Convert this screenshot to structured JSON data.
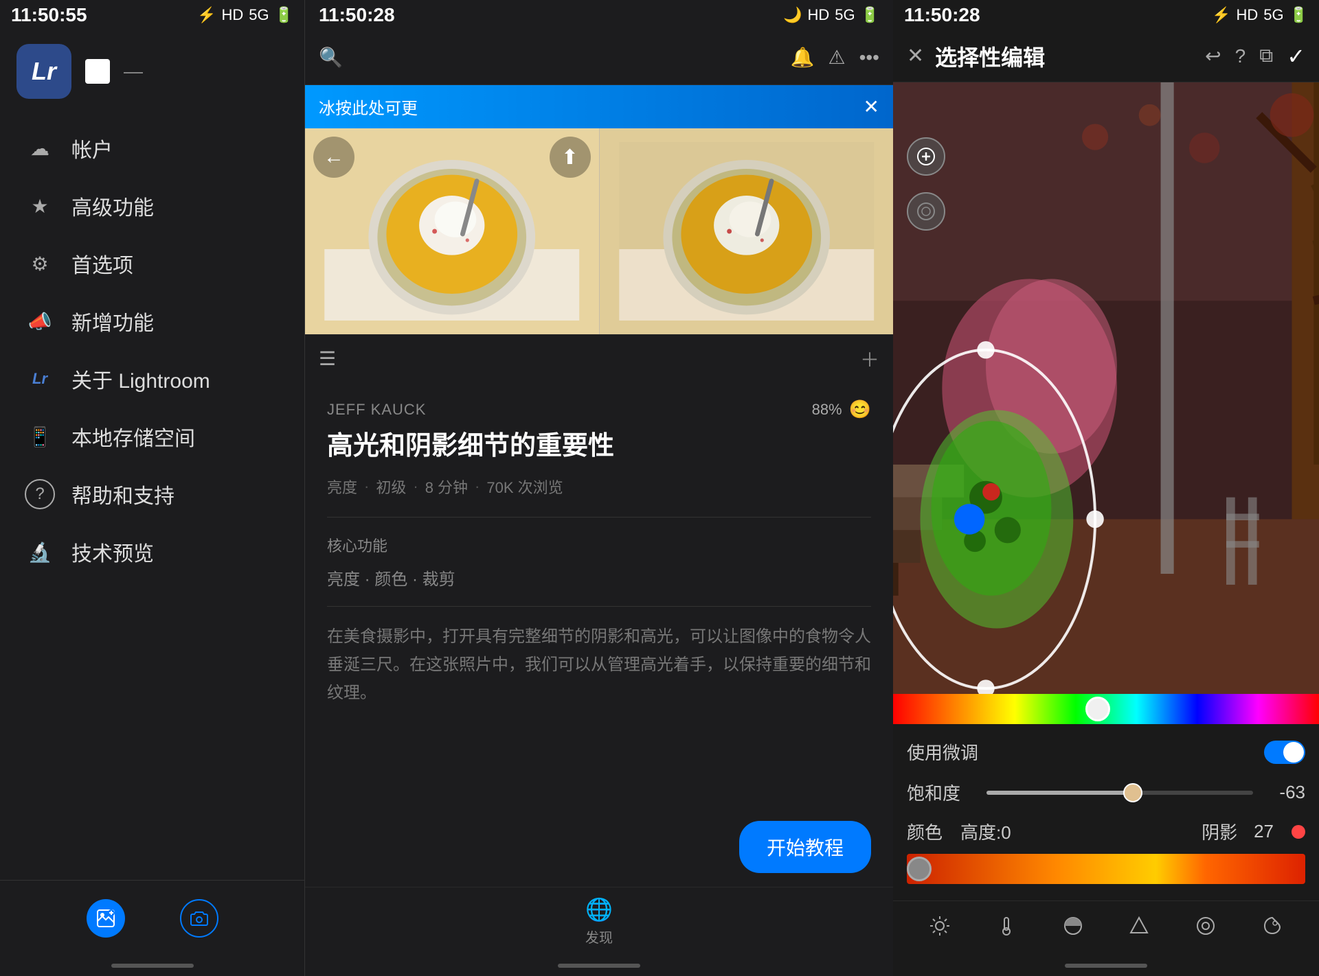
{
  "panel_left": {
    "status_bar": {
      "time": "11:50:55",
      "icons": "🔊 ⏱ A ..."
    },
    "logo": "Lr",
    "nav_items": [
      {
        "id": "account",
        "icon": "☁",
        "label": "帐户"
      },
      {
        "id": "advanced",
        "icon": "★",
        "label": "高级功能"
      },
      {
        "id": "preferences",
        "icon": "⚙",
        "label": "首选项"
      },
      {
        "id": "new_features",
        "icon": "📣",
        "label": "新增功能"
      },
      {
        "id": "about",
        "icon": "Lr",
        "label": "关于 Lightroom"
      },
      {
        "id": "local_storage",
        "icon": "📱",
        "label": "本地存储空间"
      },
      {
        "id": "help",
        "icon": "?",
        "label": "帮助和支持"
      },
      {
        "id": "tech_preview",
        "icon": "🔬",
        "label": "技术预览"
      }
    ],
    "bottom_nav": [
      {
        "id": "gallery",
        "icon": "🖼",
        "label": ""
      },
      {
        "id": "camera",
        "icon": "📷",
        "label": ""
      }
    ]
  },
  "panel_middle": {
    "status_bar": {
      "time": "11:50:28"
    },
    "header": {
      "back_icon": "←",
      "share_icon": "⎋"
    },
    "banner_text": "冰按此处可更",
    "banner_close": "✕",
    "article": {
      "author": "JEFF KAUCK",
      "rating": "88%",
      "title": "高光和阴影细节的重要性",
      "meta_brightness": "亮度",
      "meta_level": "初级",
      "meta_duration": "8 分钟",
      "meta_views": "70K 次浏览",
      "section_label": "核心功能",
      "tags": "亮度 · 颜色 · 裁剪",
      "body": "在美食摄影中，打开具有完整细节的阴影和高光，可以让图像中的食物令人垂涎三尺。在这张照片中，我们可以从管理高光着手，以保持重要的细节和纹理。"
    },
    "start_btn": "开始教程",
    "bottom_discover_label": "发现"
  },
  "panel_right": {
    "status_bar": {
      "time": "11:50:28"
    },
    "header": {
      "close_icon": "✕",
      "title": "选择性编辑",
      "undo_icon": "↩",
      "help_icon": "?",
      "compare_icon": "⧉",
      "confirm_icon": "✓"
    },
    "controls": {
      "fine_tune_label": "使用微调",
      "fine_tune_on": true,
      "saturation_label": "饱和度",
      "saturation_value": "-63",
      "saturation_percent": 55,
      "color_label": "颜色",
      "color_height_label": "高度:0",
      "shadow_label": "阴影",
      "shadow_value": "27"
    },
    "toolbar_items": [
      {
        "id": "light",
        "icon": "☀"
      },
      {
        "id": "temperature",
        "icon": "🌡"
      },
      {
        "id": "tone",
        "icon": "◐"
      },
      {
        "id": "detail",
        "icon": "▲"
      },
      {
        "id": "hsl",
        "icon": "◎"
      },
      {
        "id": "effect",
        "icon": "✦"
      }
    ]
  }
}
